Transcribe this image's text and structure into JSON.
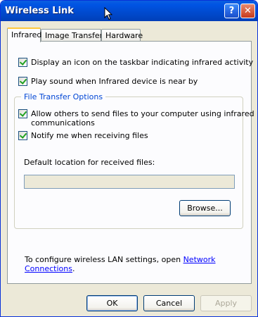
{
  "window": {
    "title": "Wireless Link",
    "help_label": "?",
    "close_label": "✕"
  },
  "tabs": [
    {
      "label": "Infrared",
      "active": true
    },
    {
      "label": "Image Transfer",
      "active": false
    },
    {
      "label": "Hardware",
      "active": false
    }
  ],
  "options": {
    "taskbar_icon": {
      "label": "Display an icon on the taskbar indicating infrared activity",
      "checked": true
    },
    "play_sound": {
      "label": "Play sound when Infrared device is near by",
      "checked": true
    }
  },
  "file_transfer": {
    "group_title": "File Transfer Options",
    "allow_send_line1": "Allow others to send files to your computer using infrared",
    "allow_send_line2": "communications",
    "allow_send_checked": true,
    "notify_label": "Notify me when receiving files",
    "notify_checked": true,
    "location_label": "Default location for received files:",
    "location_value": "",
    "browse_label": "Browse..."
  },
  "footer": {
    "configure_text": "To configure wireless LAN settings, open ",
    "link_text": "Network Connections",
    "period": "."
  },
  "buttons": {
    "ok": "OK",
    "cancel": "Cancel",
    "apply": "Apply"
  },
  "colors": {
    "titlebar": "#0054E3",
    "panel": "#FCFCFE",
    "dialog": "#ECE9D8",
    "group_title": "#0046D5",
    "link": "#0000FF"
  }
}
